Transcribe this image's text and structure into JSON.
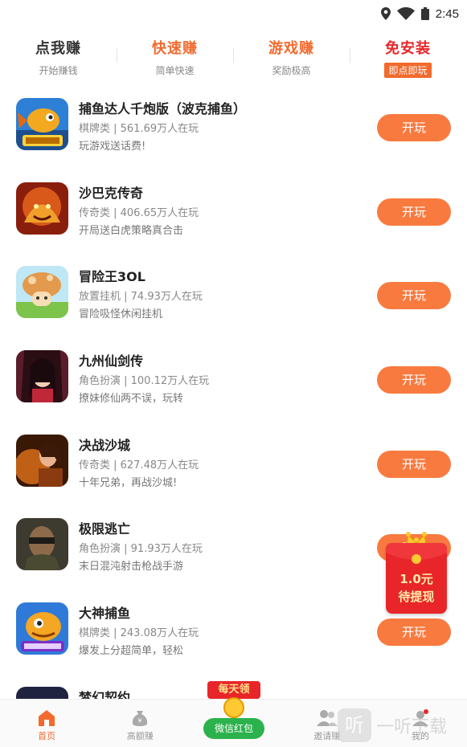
{
  "status": {
    "time": "2:45",
    "icons": [
      "location-icon",
      "wifi-icon",
      "battery-icon"
    ]
  },
  "tabs": [
    {
      "title": "点我赚",
      "sub": "开始赚钱",
      "color": "#333333"
    },
    {
      "title": "快速赚",
      "sub": "简单快速",
      "color": "#f26a2d"
    },
    {
      "title": "游戏赚",
      "sub": "奖励极高",
      "color": "#f26a2d"
    },
    {
      "title": "免安装",
      "badge": "即点即玩",
      "color": "#e8262a"
    }
  ],
  "games": [
    {
      "name": "捕鱼达人千炮版（波克捕鱼）",
      "meta": "棋牌类 | 561.69万人在玩",
      "desc": "玩游戏送话费!",
      "button": "开玩",
      "icon": "fish-game-icon"
    },
    {
      "name": "沙巴克传奇",
      "meta": "传奇类 | 406.65万人在玩",
      "desc": "开局送白虎策略真合击",
      "button": "开玩",
      "icon": "dragon-game-icon"
    },
    {
      "name": "冒险王3OL",
      "meta": "放置挂机 | 74.93万人在玩",
      "desc": "冒险吸怪休闲挂机",
      "button": "开玩",
      "icon": "mushroom-game-icon"
    },
    {
      "name": "九州仙剑传",
      "meta": "角色扮演 | 100.12万人在玩",
      "desc": "撩妹修仙两不误，玩转",
      "button": "开玩",
      "icon": "fairy-game-icon"
    },
    {
      "name": "决战沙城",
      "meta": "传奇类 | 627.48万人在玩",
      "desc": "十年兄弟，再战沙城!",
      "button": "开玩",
      "icon": "warrior-game-icon"
    },
    {
      "name": "极限逃亡",
      "meta": "角色扮演 | 91.93万人在玩",
      "desc": "末日混沌射击枪战手游",
      "button": "开玩",
      "icon": "soldier-game-icon"
    },
    {
      "name": "大神捕鱼",
      "meta": "棋牌类 | 243.08万人在玩",
      "desc": "爆发上分超简单，轻松",
      "button": "开玩",
      "icon": "fish-cartoon-game-icon"
    },
    {
      "name": "梦幻契约",
      "meta": "",
      "desc": "",
      "button": "",
      "icon": "dream-game-icon"
    }
  ],
  "float_envelope": {
    "amount": "1.0元",
    "label": "待提现"
  },
  "nav": [
    {
      "label": "首页",
      "icon": "home-icon",
      "active": true
    },
    {
      "label": "高额赚",
      "icon": "money-bag-icon"
    },
    {
      "label": "",
      "icon": ""
    },
    {
      "label": "邀请赚",
      "icon": "people-icon"
    },
    {
      "label": "我的",
      "icon": "person-icon"
    }
  ],
  "center_badge": {
    "top": "每天领",
    "bottom": "微信红包"
  },
  "watermark": {
    "box": "听",
    "text": "一听下载"
  },
  "colors": {
    "accent": "#f97a3f",
    "red": "#e8262a",
    "green": "#2bb24c"
  }
}
